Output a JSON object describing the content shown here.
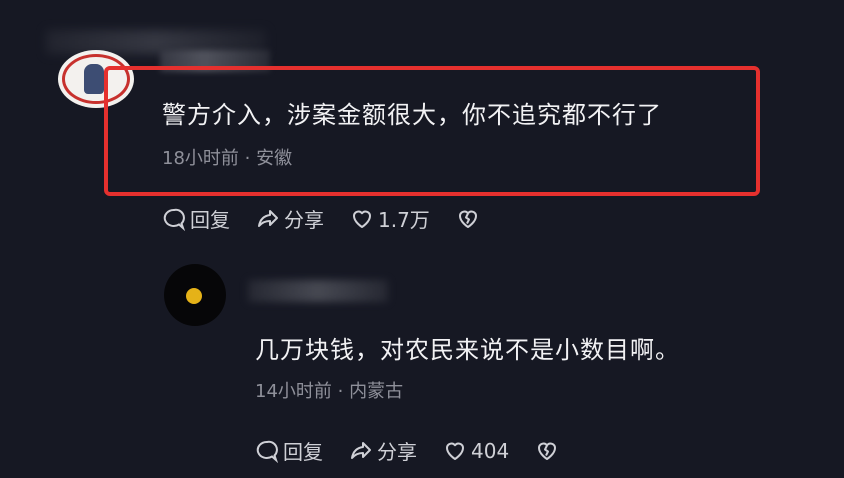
{
  "comments": [
    {
      "text": "警方介入，涉案金额很大，你不追究都不行了",
      "meta": "18小时前 · 安徽",
      "actions": {
        "reply": "回复",
        "share": "分享",
        "likes": "1.7万"
      }
    }
  ],
  "reply": {
    "text": "几万块钱，对农民来说不是小数目啊。",
    "meta": "14小时前 · 内蒙古",
    "actions": {
      "reply": "回复",
      "share": "分享",
      "likes": "404"
    }
  },
  "colors": {
    "background": "#161823",
    "highlight": "#e5302e",
    "meta": "#8f909a"
  },
  "icons": [
    "comment-icon",
    "share-icon",
    "heart-icon",
    "broken-heart-icon"
  ]
}
